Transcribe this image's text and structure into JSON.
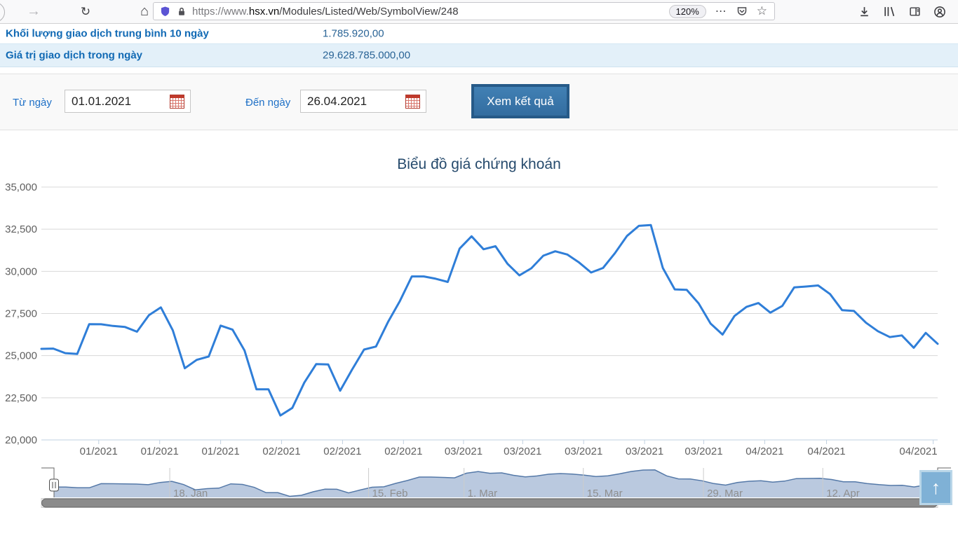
{
  "browser": {
    "url_protocol": "https://www.",
    "url_domain": "hsx.vn",
    "url_path": "/Modules/Listed/Web/SymbolView/248",
    "zoom_badge": "120%"
  },
  "icons": {
    "forward": "→",
    "reload": "↻",
    "home": "⌂",
    "dots": "⋯",
    "star": "☆",
    "up_arrow": "↑"
  },
  "table": {
    "rows": [
      {
        "label": "Khối lượng giao dịch trung bình 10 ngày",
        "value": "1.785.920,00"
      },
      {
        "label": "Giá trị giao dịch trong ngày",
        "value": "29.628.785.000,00"
      }
    ]
  },
  "filter": {
    "from_label": "Từ ngày",
    "from_value": "01.01.2021",
    "to_label": "Đến ngày",
    "to_value": "26.04.2021",
    "submit_label": "Xem kết quả"
  },
  "chart_data": {
    "type": "line",
    "title": "Biểu đồ giá chứng khoán",
    "date_range": [
      "01.01.2021",
      "26.04.2021"
    ],
    "ylim": [
      20000,
      35000
    ],
    "yticks": [
      {
        "value": 20000,
        "label": "20,000"
      },
      {
        "value": 22500,
        "label": "22,500"
      },
      {
        "value": 25000,
        "label": "25,000"
      },
      {
        "value": 27500,
        "label": "27,500"
      },
      {
        "value": 30000,
        "label": "30,000"
      },
      {
        "value": 32500,
        "label": "32,500"
      },
      {
        "value": 35000,
        "label": "35,000"
      }
    ],
    "xticks": [
      {
        "pos": 0.064,
        "label": "01/2021"
      },
      {
        "pos": 0.132,
        "label": "01/2021"
      },
      {
        "pos": 0.2,
        "label": "01/2021"
      },
      {
        "pos": 0.268,
        "label": "02/2021"
      },
      {
        "pos": 0.336,
        "label": "02/2021"
      },
      {
        "pos": 0.404,
        "label": "02/2021"
      },
      {
        "pos": 0.471,
        "label": "03/2021"
      },
      {
        "pos": 0.537,
        "label": "03/2021"
      },
      {
        "pos": 0.605,
        "label": "03/2021"
      },
      {
        "pos": 0.673,
        "label": "03/2021"
      },
      {
        "pos": 0.739,
        "label": "03/2021"
      },
      {
        "pos": 0.807,
        "label": "04/2021"
      },
      {
        "pos": 0.876,
        "label": "04/2021"
      },
      {
        "pos": 0.995,
        "label": "04/2021"
      }
    ],
    "values": [
      25400,
      25420,
      25150,
      25100,
      26870,
      26860,
      26760,
      26700,
      26420,
      27400,
      27860,
      26500,
      24250,
      24750,
      24950,
      26780,
      26540,
      25300,
      23000,
      23000,
      21450,
      21900,
      23400,
      24500,
      24480,
      22920,
      24170,
      25360,
      25540,
      26990,
      28240,
      29700,
      29700,
      29560,
      29370,
      31350,
      32080,
      31310,
      31490,
      30450,
      29760,
      30180,
      30930,
      31190,
      31000,
      30520,
      29930,
      30200,
      31080,
      32100,
      32700,
      32750,
      30200,
      28930,
      28900,
      28100,
      26900,
      26250,
      27350,
      27890,
      28120,
      27550,
      27950,
      29050,
      29100,
      29160,
      28650,
      27700,
      27650,
      26950,
      26450,
      26100,
      26200,
      25470,
      26350,
      25700
    ],
    "navigator_ticks": [
      {
        "pos": 0.131,
        "label": "18. Jan"
      },
      {
        "pos": 0.356,
        "label": "15. Feb"
      },
      {
        "pos": 0.464,
        "label": "1. Mar"
      },
      {
        "pos": 0.599,
        "label": "15. Mar"
      },
      {
        "pos": 0.735,
        "label": "29. Mar"
      },
      {
        "pos": 0.87,
        "label": "12. Apr"
      }
    ],
    "navigator": {
      "range": [
        21000,
        33000
      ],
      "fill_color": "#bac9df",
      "line_color": "#5579a8"
    },
    "colors": {
      "line": "#2f7ed8",
      "grid": "#d8d8d8",
      "axis": "#c0d0e0",
      "label": "#606060",
      "nav_label": "#8f8f8f"
    },
    "legend": "off",
    "grid": "horizontal"
  }
}
